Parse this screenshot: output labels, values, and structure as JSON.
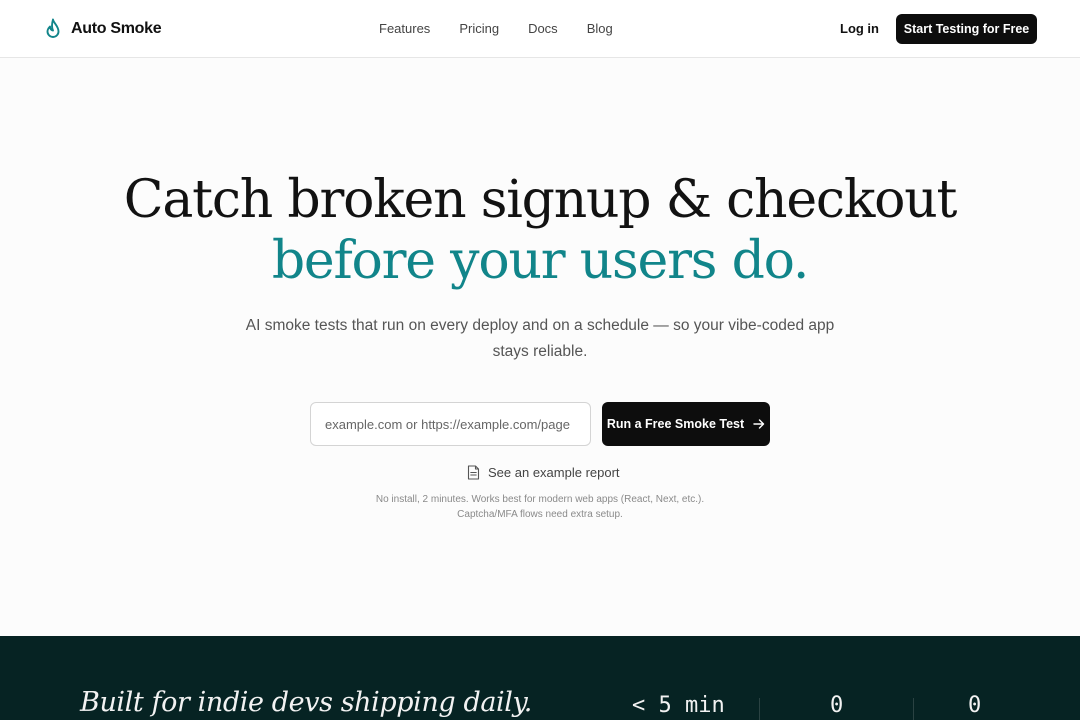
{
  "header": {
    "brand_name": "Auto Smoke",
    "nav": [
      "Features",
      "Pricing",
      "Docs",
      "Blog"
    ],
    "login_label": "Log in",
    "cta_label": "Start Testing for Free"
  },
  "hero": {
    "headline_line1": "Catch broken signup & checkout",
    "headline_line2": "before your users do.",
    "subhead_line1": "AI smoke tests that run on every deploy and on a schedule — so your vibe-coded app",
    "subhead_line2": "stays reliable.",
    "url_placeholder": "example.com or https://example.com/page",
    "url_value": "",
    "run_button_label": "Run a Free Smoke Test",
    "example_link_label": "See an example report",
    "fineprint_line1": "No install, 2 minutes. Works best for modern web apps (React, Next, etc.).",
    "fineprint_line2": "Captcha/MFA flows need extra setup."
  },
  "band": {
    "title": "Built for indie devs shipping daily.",
    "stats": [
      "< 5 min",
      "0",
      "0"
    ]
  },
  "colors": {
    "accent": "#11858a",
    "dark_band": "#062323",
    "button": "#0d0d0d"
  },
  "icons": {
    "brand": "flame-icon",
    "run_button": "arrow-right-icon",
    "example_link": "document-icon"
  }
}
